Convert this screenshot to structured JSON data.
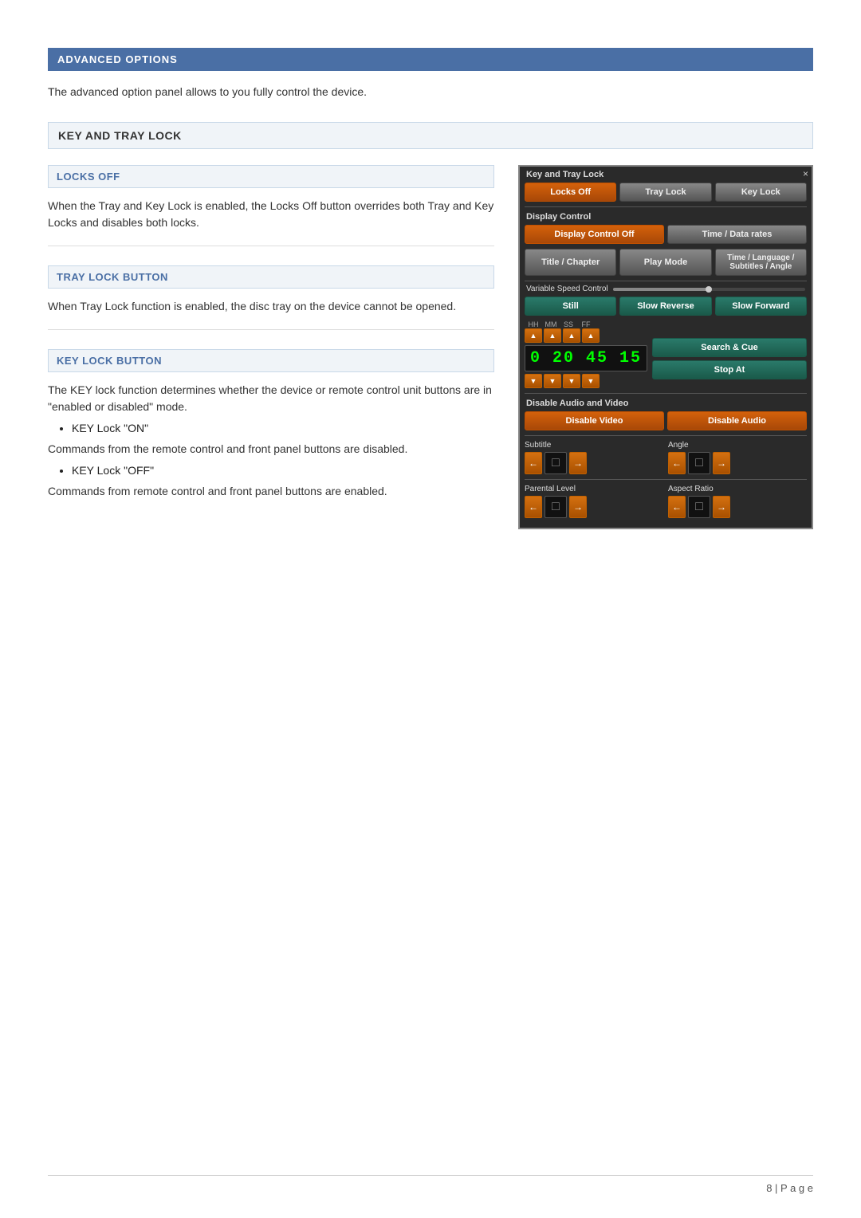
{
  "page": {
    "title": "ADVANCED OPTIONS",
    "intro": "The advanced option panel allows to you fully control the device.",
    "page_number": "8 | P a g e"
  },
  "sections": {
    "key_tray_lock": {
      "header": "KEY AND TRAY LOCK"
    },
    "locks_off": {
      "header": "LOCKS OFF",
      "content": "When the Tray and Key Lock is enabled, the Locks Off button overrides both Tray and Key Locks and disables both locks."
    },
    "tray_lock": {
      "header": "TRAY LOCK BUTTON",
      "content": "When Tray Lock function is enabled, the disc tray on the device cannot be opened."
    },
    "key_lock": {
      "header": "KEY LOCK BUTTON",
      "content": "The KEY lock function determines whether the device or remote control unit buttons are in \"enabled or disabled\" mode.",
      "bullet1": "KEY Lock \"ON\"",
      "content2": "Commands from the remote control and front panel buttons are disabled.",
      "bullet2": "KEY Lock \"OFF\"",
      "content3": "Commands from remote control and front panel buttons are enabled."
    }
  },
  "dialog": {
    "title": "Key and Tray Lock",
    "close_btn": "×",
    "locks_off_btn": "Locks Off",
    "tray_lock_btn": "Tray Lock",
    "key_lock_btn": "Key Lock",
    "display_control_label": "Display Control",
    "display_control_off_btn": "Display Control Off",
    "time_data_rates_btn": "Time / Data rates",
    "title_chapter_btn": "Title / Chapter",
    "play_mode_btn": "Play Mode",
    "time_language_btn": "Time / Language / Subtitles / Angle",
    "variable_speed_label": "Variable Speed Control",
    "still_btn": "Still",
    "slow_reverse_btn": "Slow Reverse",
    "slow_forward_btn": "Slow Forward",
    "hh_label": "HH",
    "mm_label": "MM",
    "ss_label": "SS",
    "ff_label": "FF",
    "time_value": "0 20 45 15",
    "search_cue_btn": "Search & Cue",
    "stop_at_btn": "Stop At",
    "disable_audio_video_label": "Disable Audio and Video",
    "disable_video_btn": "Disable Video",
    "disable_audio_btn": "Disable Audio",
    "subtitle_label": "Subtitle",
    "angle_label": "Angle",
    "parental_level_label": "Parental Level",
    "aspect_ratio_label": "Aspect Ratio",
    "left_arrow": "←",
    "right_arrow": "→",
    "empty_display": "□"
  }
}
